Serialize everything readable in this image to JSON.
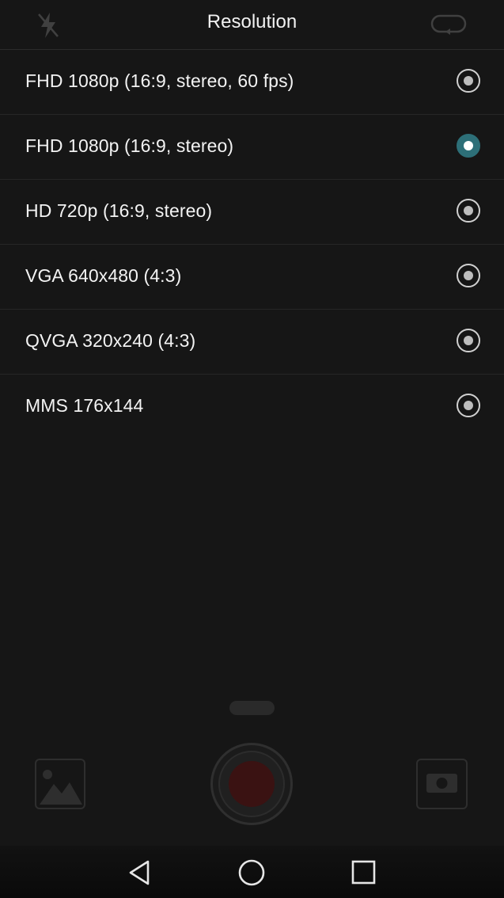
{
  "header": {
    "title": "Resolution",
    "left_icon": "flash-off-icon",
    "right_icon": "switch-camera-icon"
  },
  "options": [
    {
      "label": "FHD 1080p (16:9, stereo, 60 fps)",
      "selected": false
    },
    {
      "label": "FHD 1080p (16:9, stereo)",
      "selected": true
    },
    {
      "label": "HD 720p (16:9, stereo)",
      "selected": false
    },
    {
      "label": "VGA 640x480 (4:3)",
      "selected": false
    },
    {
      "label": "QVGA 320x240 (4:3)",
      "selected": false
    },
    {
      "label": "MMS 176x144",
      "selected": false
    }
  ],
  "colors": {
    "background": "#161616",
    "accent": "#2d6f78",
    "record": "#3a1212"
  },
  "navbar": {
    "buttons": [
      "back-icon",
      "home-icon",
      "recent-apps-icon"
    ]
  }
}
